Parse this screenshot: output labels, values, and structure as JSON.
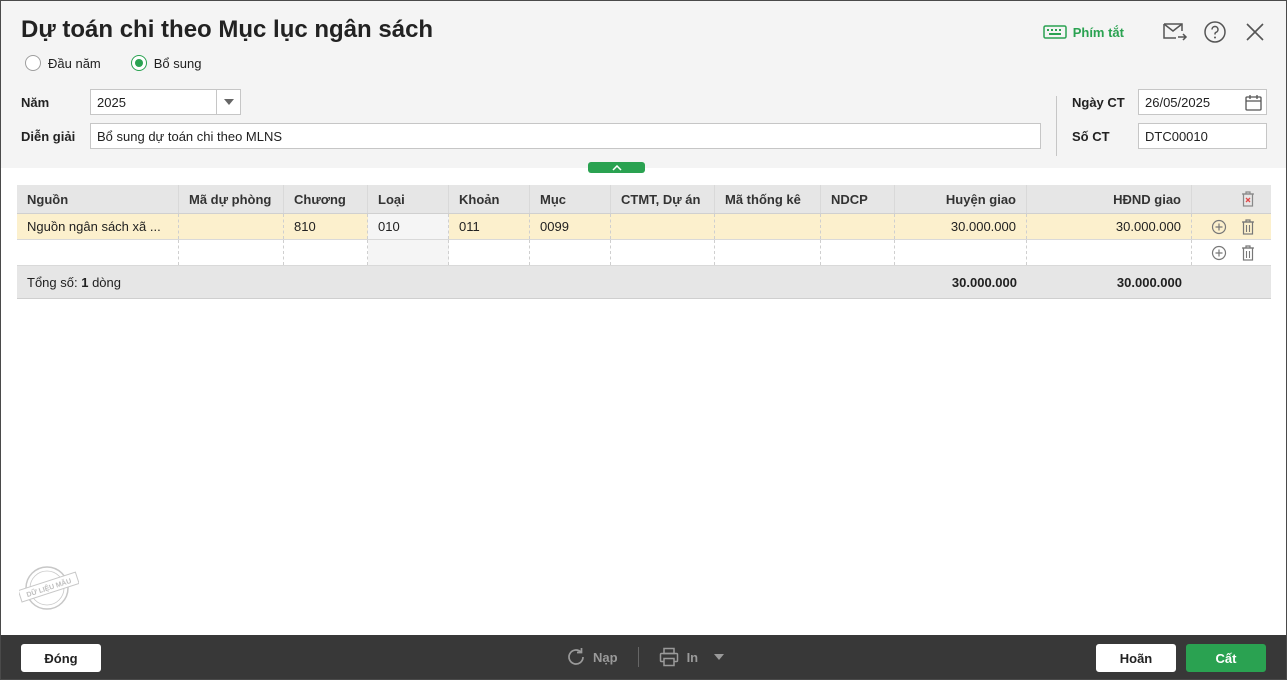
{
  "dialog": {
    "title": "Dự toán chi theo Mục lục ngân sách",
    "shortcut_label": "Phím tắt"
  },
  "type_options": [
    {
      "label": "Đầu năm",
      "checked": false
    },
    {
      "label": "Bổ sung",
      "checked": true
    }
  ],
  "form": {
    "year_label": "Năm",
    "year_value": "2025",
    "description_label": "Diễn giải",
    "description_value": "Bổ sung dự toán chi theo MLNS",
    "date_label": "Ngày CT",
    "date_value": "26/05/2025",
    "doc_no_label": "Số CT",
    "doc_no_value": "DTC00010"
  },
  "grid": {
    "columns": [
      "Nguồn",
      "Mã dự phòng",
      "Chương",
      "Loại",
      "Khoản",
      "Mục",
      "CTMT, Dự án",
      "Mã thống kê",
      "NDCP",
      "Huyện giao",
      "HĐND giao"
    ],
    "rows": [
      [
        "Nguồn ngân sách xã ...",
        "",
        "810",
        "010",
        "011",
        "0099",
        "",
        "",
        "",
        "30.000.000",
        "30.000.000"
      ],
      [
        "",
        "",
        "",
        "",
        "",
        "",
        "",
        "",
        "",
        "",
        ""
      ]
    ],
    "total_prefix": "Tổng số: ",
    "total_count": "1",
    "total_suffix": " dòng",
    "total_huyen": "30.000.000",
    "total_hdnd": "30.000.000"
  },
  "stamp_text": "DỮ LIỆU MẪU",
  "footer": {
    "close_label": "Đóng",
    "reload_label": "Nạp",
    "print_label": "In",
    "cancel_label": "Hoãn",
    "save_label": "Cất"
  },
  "colors": {
    "accent": "#2aa251",
    "selected_row": "#fcf0cd",
    "footer_bg": "#383838"
  }
}
